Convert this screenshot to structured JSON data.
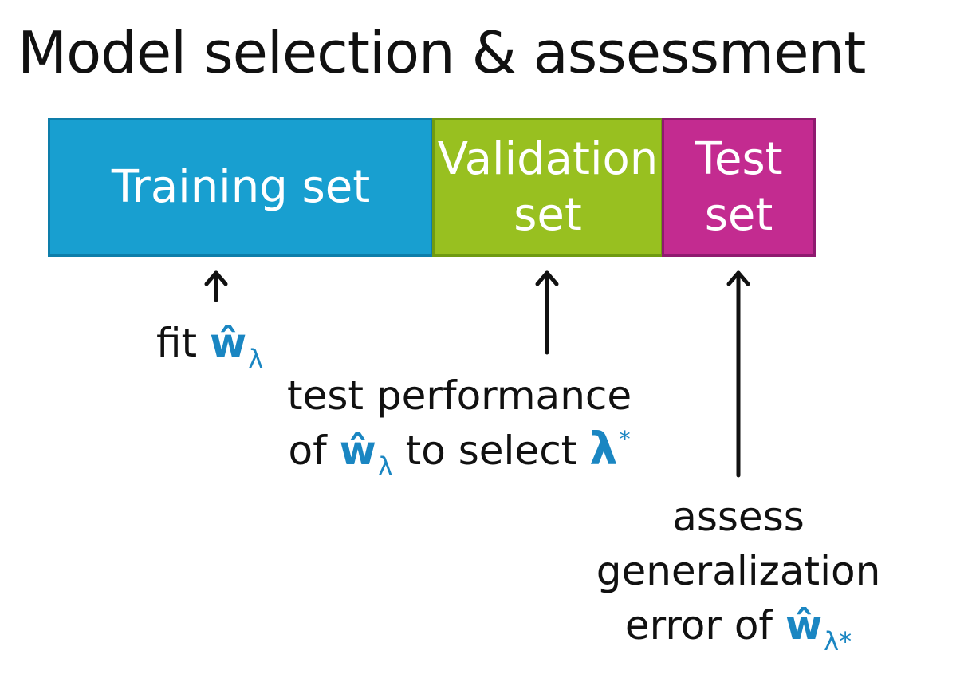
{
  "title": "Model selection & assessment",
  "colors": {
    "training": "#189fd0",
    "validation": "#98c020",
    "test": "#c32b90",
    "highlight": "#1a86c2"
  },
  "boxes": {
    "training": {
      "label": "Training set"
    },
    "validation": {
      "label_line1": "Validation",
      "label_line2": "set"
    },
    "test": {
      "label_line1": "Test",
      "label_line2": "set"
    }
  },
  "captions": {
    "fit": {
      "word": "fit",
      "symbol": "ŵ",
      "subscript": "λ"
    },
    "validation": {
      "line1": "test performance",
      "of": "of",
      "symbol": "ŵ",
      "subscript": "λ",
      "to_select": "to select",
      "lambda": "λ",
      "star": "*"
    },
    "test": {
      "line1": "assess",
      "line2": "generalization",
      "error_of": "error of",
      "symbol": "ŵ",
      "subscript": "λ*"
    }
  }
}
